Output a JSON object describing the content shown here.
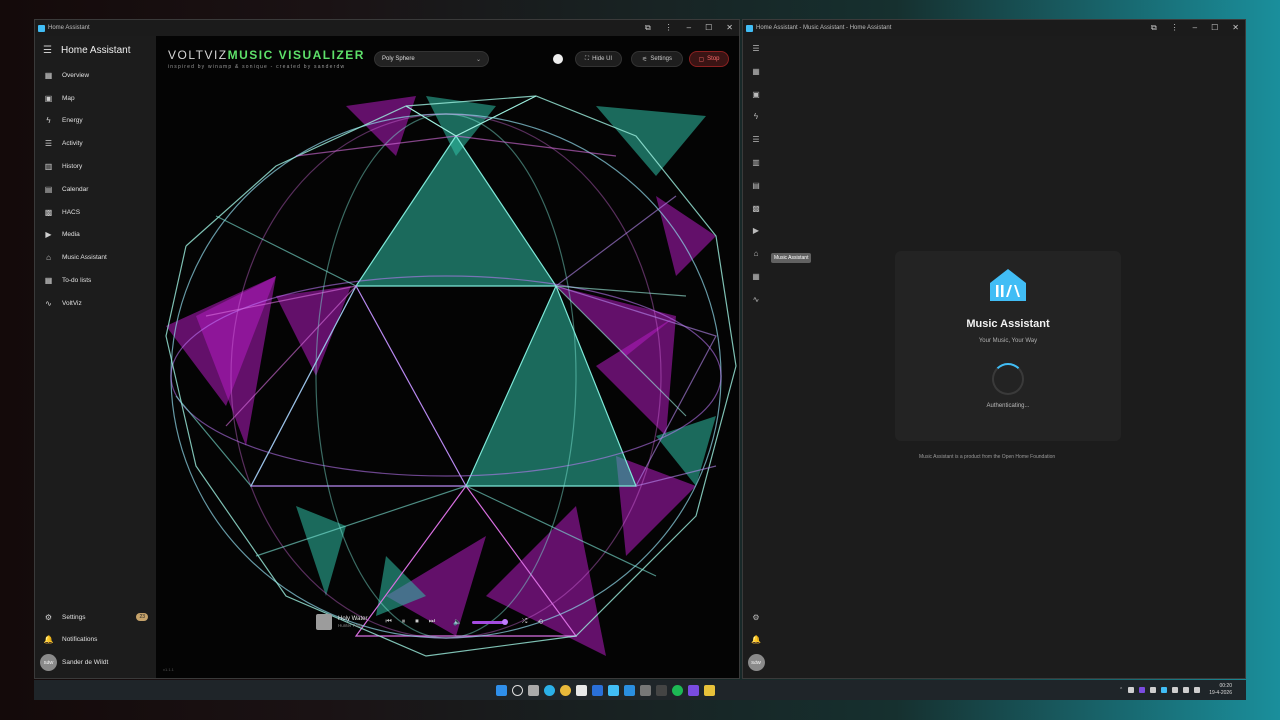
{
  "left_window": {
    "title": "Home Assistant",
    "sidebar": {
      "header": "Home Assistant",
      "items": [
        {
          "label": "Overview",
          "icon": "dashboard-icon"
        },
        {
          "label": "Map",
          "icon": "map-icon"
        },
        {
          "label": "Energy",
          "icon": "lightning-icon"
        },
        {
          "label": "Activity",
          "icon": "list-icon"
        },
        {
          "label": "History",
          "icon": "chart-icon"
        },
        {
          "label": "Calendar",
          "icon": "calendar-icon"
        },
        {
          "label": "HACS",
          "icon": "hacs-icon"
        },
        {
          "label": "Media",
          "icon": "media-icon"
        },
        {
          "label": "Music Assistant",
          "icon": "music-assistant-icon"
        },
        {
          "label": "To-do lists",
          "icon": "todo-icon"
        },
        {
          "label": "VoltViz",
          "icon": "waveform-icon"
        }
      ],
      "settings_label": "Settings",
      "settings_badge": "23",
      "notifications_label": "Notifications",
      "user_name": "Sander de Wildt",
      "user_initials": "SdW"
    },
    "visualizer": {
      "logo_prefix": "VOLTVIZ",
      "logo_main": "MUSIC VISUALIZER",
      "tagline": "inspired by winamp & sonique - created by sanderdw",
      "preset": "Poly Sphere",
      "hide_ui_label": "Hide UI",
      "settings_label": "Settings",
      "stop_label": "Stop",
      "version": "v1.1.1"
    },
    "player": {
      "track": "Holy Water",
      "artist": "Hunter Falls",
      "volume_fraction": 0.9
    }
  },
  "right_window": {
    "title": "Home Assistant - Music Assistant - Home Assistant",
    "tooltip": "Music Assistant",
    "card": {
      "title": "Music Assistant",
      "subtitle": "Your Music, Your Way",
      "status": "Authenticating..."
    },
    "footer": "Music Assistant is a product from the Open Home Foundation"
  },
  "taskbar": {
    "time": "00:20",
    "date": "19-4-2026"
  },
  "colors": {
    "accent_teal": "#2ec4b6",
    "accent_magenta": "#d11ed6",
    "ha_blue": "#41bdf5",
    "logo_green": "#5ee06a",
    "stop_red": "#e53935"
  }
}
